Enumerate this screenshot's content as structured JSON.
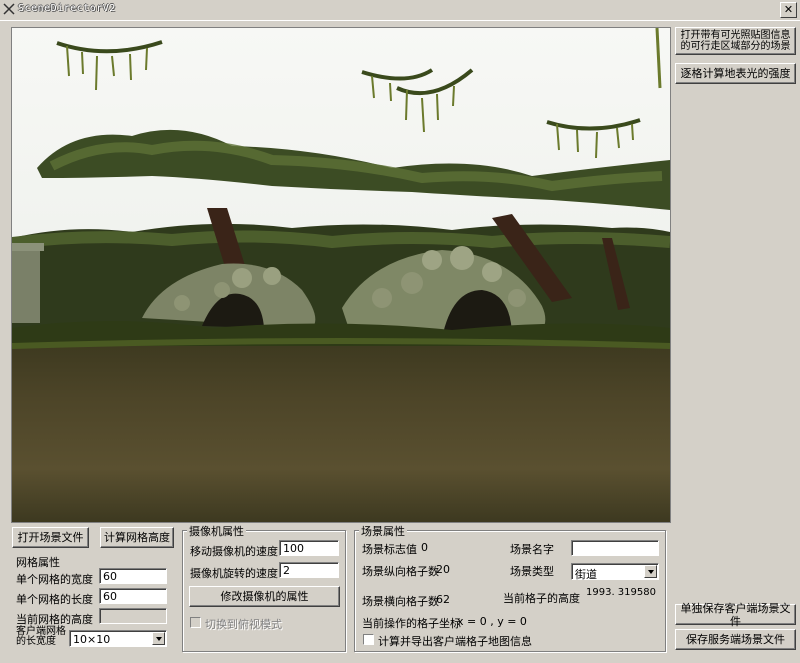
{
  "window": {
    "title": "SceneDirectorV2",
    "close_label": "✕"
  },
  "right_panel": {
    "open_lit_scene_button": "打开带有可光照贴图信息的可行走区域部分的场景",
    "calc_light_button": "逐格计算地表光的强度",
    "save_client_scene_button": "单独保存客户端场景文件",
    "save_server_scene_button": "保存服务端场景文件"
  },
  "toolbar": {
    "open_scene_button": "打开场景文件",
    "calc_grid_height_button": "计算网格高度"
  },
  "grid_props": {
    "title": "网格属性",
    "width_label": "单个网格的宽度",
    "width_value": "60",
    "length_label": "单个网格的长度",
    "length_value": "60",
    "current_height_label": "当前网格的高度",
    "current_height_value": "",
    "client_grid_label": "客户端网格的长宽度",
    "client_grid_value": "10×10"
  },
  "camera_props": {
    "title": "摄像机属性",
    "move_speed_label": "移动摄像机的速度",
    "move_speed_value": "100",
    "rotate_speed_label": "摄像机旋转的速度",
    "rotate_speed_value": "2",
    "modify_button": "修改摄像机的属性",
    "topdown_label": "切换到俯视模式"
  },
  "scene_props": {
    "title": "场景属性",
    "flag_label": "场景标志值",
    "flag_value": "0",
    "name_label": "场景名字",
    "name_value": "",
    "vertical_grid_label": "场景纵向格子数",
    "vertical_grid_value": "20",
    "type_label": "场景类型",
    "type_value": "街道",
    "horizontal_grid_label": "场景横向格子数",
    "horizontal_grid_value": "62",
    "current_grid_height_label": "当前格子的高度",
    "current_grid_height_value": "1993. 319580",
    "current_coord_label": "当前操作的格子坐标",
    "current_coord_value": "x = 0 ,  y = 0",
    "export_label": "计算并导出客户端格子地图信息"
  }
}
